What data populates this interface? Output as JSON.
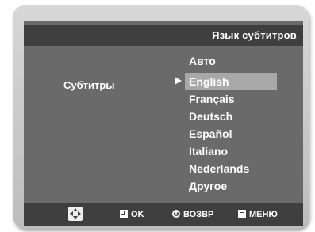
{
  "title": "Язык субтитров",
  "field_label": "Субтитры",
  "options": [
    {
      "label": "Авто",
      "selected": false
    },
    {
      "label": "English",
      "selected": true
    },
    {
      "label": "Français",
      "selected": false
    },
    {
      "label": "Deutsch",
      "selected": false
    },
    {
      "label": "Español",
      "selected": false
    },
    {
      "label": "Italiano",
      "selected": false
    },
    {
      "label": "Nederlands",
      "selected": false
    },
    {
      "label": "Другое",
      "selected": false
    }
  ],
  "footer": {
    "navigate_icon": "dpad-icon",
    "ok_label": "OK",
    "back_label": "ВОЗВР",
    "menu_label": "МЕНЮ"
  },
  "colors": {
    "screen_bg": "#6a6a6a",
    "bar_bg": "#3f3f3f",
    "highlight": "#a8a8a8",
    "text": "#ffffff"
  }
}
